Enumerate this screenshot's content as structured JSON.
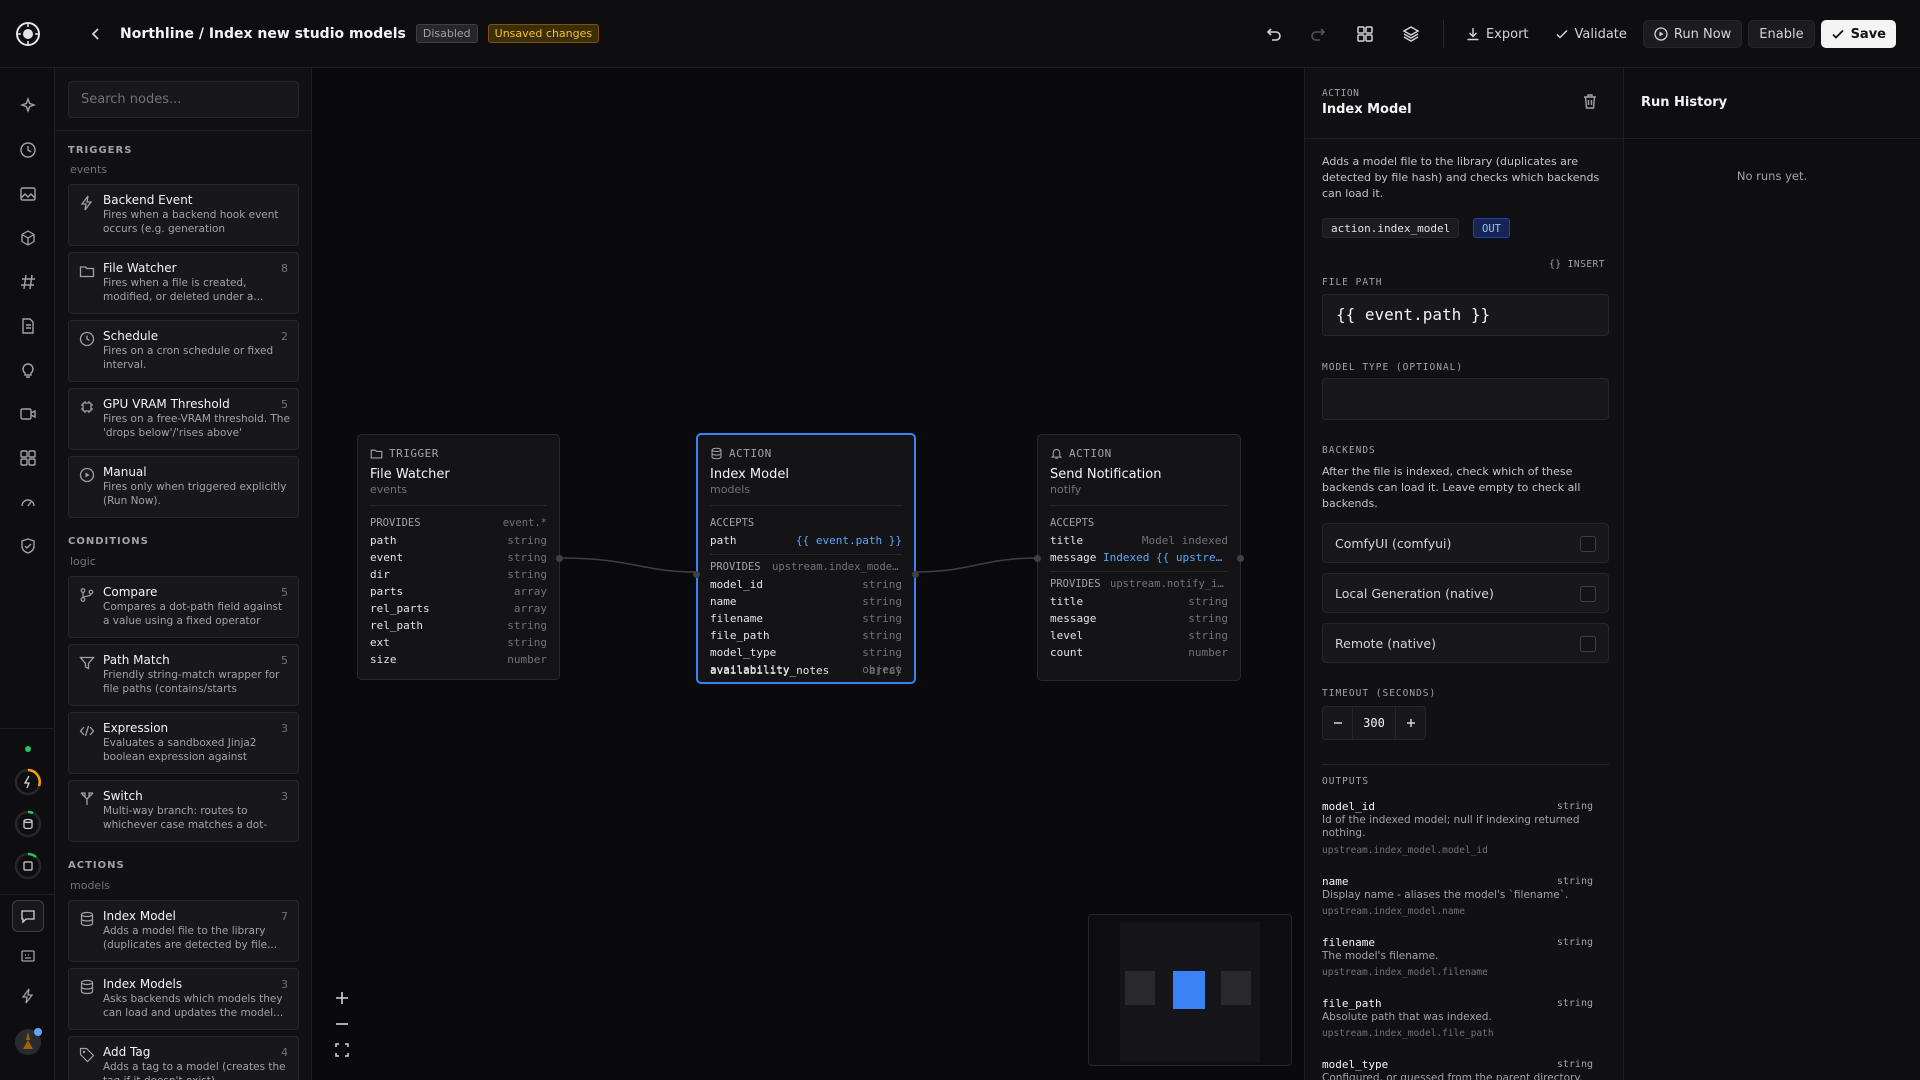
{
  "header": {
    "breadcrumb": "Northline / Index new studio models",
    "badge_disabled": "Disabled",
    "badge_unsaved": "Unsaved changes",
    "export_label": "Export",
    "validate_label": "Validate",
    "run_now_label": "Run Now",
    "enable_label": "Enable",
    "save_label": "Save"
  },
  "palette": {
    "search_placeholder": "Search nodes...",
    "sections": {
      "triggers": {
        "title": "TRIGGERS",
        "sub": "events"
      },
      "conditions": {
        "title": "CONDITIONS",
        "sub": "logic"
      },
      "actions": {
        "title": "ACTIONS",
        "sub": "models"
      }
    },
    "items": [
      {
        "title": "Backend Event",
        "count": "",
        "desc": "Fires when a backend hook event occurs (e.g. generation completed..."
      },
      {
        "title": "File Watcher",
        "count": "8",
        "desc": "Fires when a file is created, modified, or deleted under a..."
      },
      {
        "title": "Schedule",
        "count": "2",
        "desc": "Fires on a cron schedule or fixed interval."
      },
      {
        "title": "GPU VRAM Threshold",
        "count": "5",
        "desc": "Fires on a free-VRAM threshold. The 'drops below'/'rises above' directio..."
      },
      {
        "title": "Manual",
        "count": "",
        "desc": "Fires only when triggered explicitly (Run Now)."
      },
      {
        "title": "Compare",
        "count": "5",
        "desc": "Compares a dot-path field against a value using a fixed operator table."
      },
      {
        "title": "Path Match",
        "count": "5",
        "desc": "Friendly string-match wrapper for file paths (contains/starts with/end..."
      },
      {
        "title": "Expression",
        "count": "3",
        "desc": "Evaluates a sandboxed Jinja2 boolean expression against {even..."
      },
      {
        "title": "Switch",
        "count": "3",
        "desc": "Multi-way branch: routes to whichever case matches a dot-pat..."
      },
      {
        "title": "Index Model",
        "count": "7",
        "desc": "Adds a model file to the library (duplicates are detected by file..."
      },
      {
        "title": "Index Models",
        "count": "3",
        "desc": "Asks backends which models they can load and updates the model..."
      },
      {
        "title": "Add Tag",
        "count": "4",
        "desc": "Adds a tag to a model (creates the tag if it doesn't exist)."
      }
    ]
  },
  "nodes": {
    "trigger": {
      "kind": "TRIGGER",
      "title": "File Watcher",
      "sub": "events",
      "provides_label": "PROVIDES",
      "provides_value": "event.*",
      "fields": [
        {
          "k": "path",
          "t": "string"
        },
        {
          "k": "event",
          "t": "string"
        },
        {
          "k": "dir",
          "t": "string"
        },
        {
          "k": "parts",
          "t": "array"
        },
        {
          "k": "rel_parts",
          "t": "array"
        },
        {
          "k": "rel_path",
          "t": "string"
        },
        {
          "k": "ext",
          "t": "string"
        },
        {
          "k": "size",
          "t": "number"
        }
      ]
    },
    "action": {
      "kind": "ACTION",
      "title": "Index Model",
      "sub": "models",
      "accepts_label": "ACCEPTS",
      "accepts": [
        {
          "k": "path",
          "v": "{{ event.path }}"
        }
      ],
      "provides_label": "PROVIDES",
      "provides_value": "upstream.index_model.*",
      "fields": [
        {
          "k": "model_id",
          "t": "string"
        },
        {
          "k": "name",
          "t": "string"
        },
        {
          "k": "filename",
          "t": "string"
        },
        {
          "k": "file_path",
          "t": "string"
        },
        {
          "k": "model_type",
          "t": "string"
        },
        {
          "k": "availability",
          "t": "object"
        },
        {
          "k": "availability_notes",
          "t": "array"
        }
      ]
    },
    "notify": {
      "kind": "ACTION",
      "title": "Send Notification",
      "sub": "notify",
      "accepts_label": "ACCEPTS",
      "accepts": [
        {
          "k": "title",
          "v": "Model indexed"
        },
        {
          "k": "message",
          "v": "Indexed {{ upstream.index_model.name }}"
        }
      ],
      "provides_label": "PROVIDES",
      "provides_value": "upstream.notify_index.*",
      "fields": [
        {
          "k": "title",
          "t": "string"
        },
        {
          "k": "message",
          "t": "string"
        },
        {
          "k": "level",
          "t": "string"
        },
        {
          "k": "count",
          "t": "number"
        }
      ]
    }
  },
  "inspector": {
    "kind": "ACTION",
    "title": "Index Model",
    "description": "Adds a model file to the library (duplicates are detected by file hash) and checks which backends can load it.",
    "code": "action.index_model",
    "out_badge": "OUT",
    "insert_label": "{} INSERT",
    "file_path_label": "FILE PATH",
    "file_path_value": "{{ event.path }}",
    "model_type_label": "MODEL TYPE (OPTIONAL)",
    "model_type_value": "",
    "backends_label": "BACKENDS",
    "backends_desc": "After the file is indexed, check which of these backends can load it. Leave empty to check all backends.",
    "backends": [
      "ComfyUI (comfyui)",
      "Local Generation (native)",
      "Remote (native)"
    ],
    "timeout_label": "TIMEOUT (SECONDS)",
    "timeout_value": "300",
    "outputs_label": "OUTPUTS",
    "outputs": [
      {
        "k": "model_id",
        "t": "string",
        "d": "Id of the indexed model; null if indexing returned nothing.",
        "p": "upstream.index_model.model_id"
      },
      {
        "k": "name",
        "t": "string",
        "d": "Display name - aliases the model's `filename`.",
        "p": "upstream.index_model.name"
      },
      {
        "k": "filename",
        "t": "string",
        "d": "The model's filename.",
        "p": "upstream.index_model.filename"
      },
      {
        "k": "file_path",
        "t": "string",
        "d": "Absolute path that was indexed.",
        "p": "upstream.index_model.file_path"
      },
      {
        "k": "model_type",
        "t": "string",
        "d": "Configured, or guessed from the parent directory.",
        "p": ""
      }
    ]
  },
  "history": {
    "title": "Run History",
    "empty": "No runs yet."
  },
  "colors": {
    "accent": "#3b82f6",
    "warning": "#fbbf24",
    "status_ok": "#22c55e"
  }
}
